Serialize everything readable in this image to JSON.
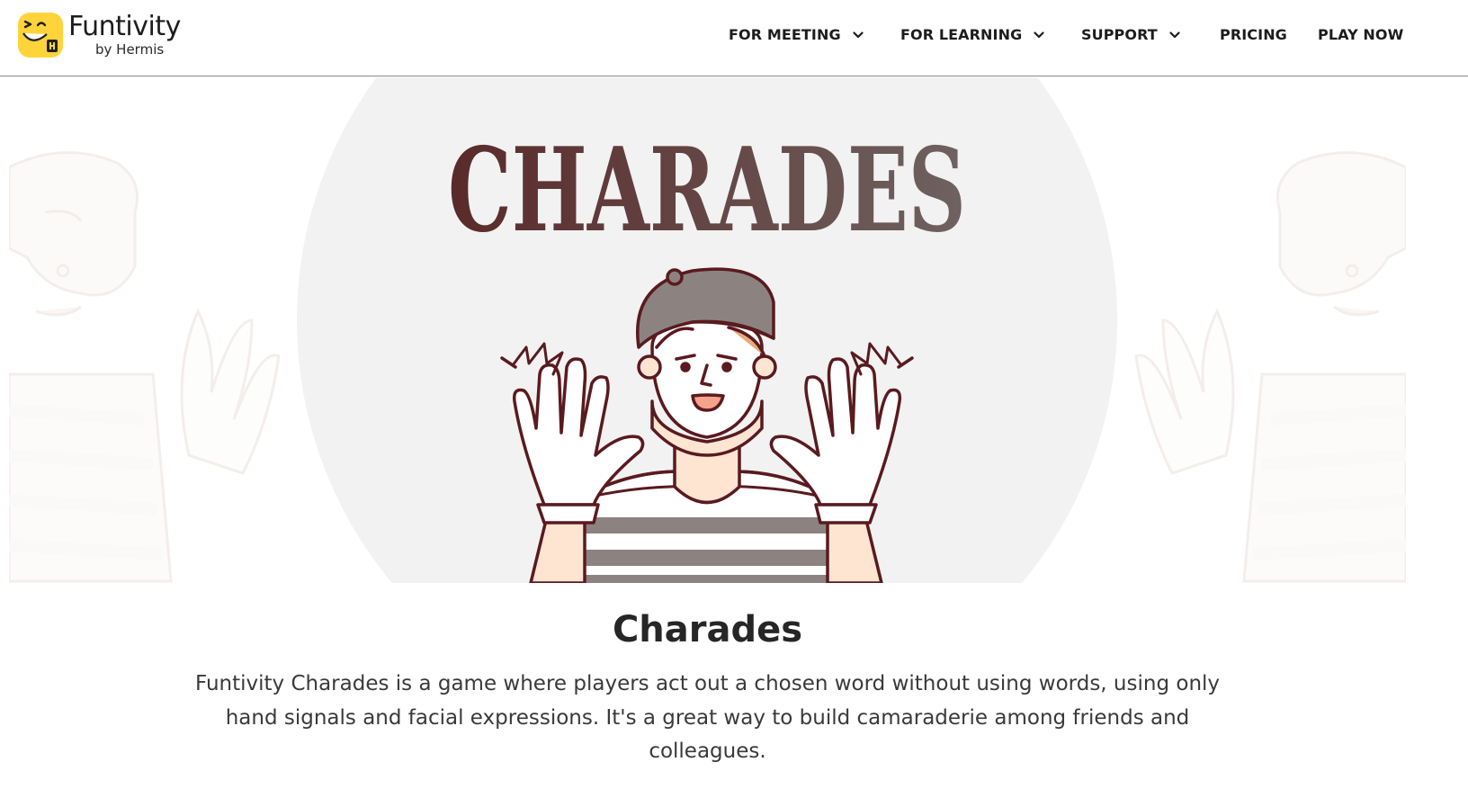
{
  "brand": {
    "name": "Funtivity",
    "byline": "by Hermis",
    "logo_color": "#FFD43B"
  },
  "nav": {
    "items": [
      {
        "label": "FOR MEETING",
        "icon": "chevron-down-icon"
      },
      {
        "label": "FOR LEARNING",
        "icon": "chevron-down-icon"
      },
      {
        "label": "SUPPORT",
        "icon": "chevron-down-icon"
      },
      {
        "label": "PRICING"
      },
      {
        "label": "PLAY NOW"
      }
    ]
  },
  "hero": {
    "title": "CHARADES",
    "title_color": "#5e3232",
    "illustration": "mime-waving-hands",
    "accent": "#5a1a1f"
  },
  "content": {
    "heading": "Charades",
    "description": "Funtivity Charades is a game where players act out a chosen word without using words, using only hand signals and facial expressions. It's a great way to build camaraderie among friends and colleagues."
  }
}
